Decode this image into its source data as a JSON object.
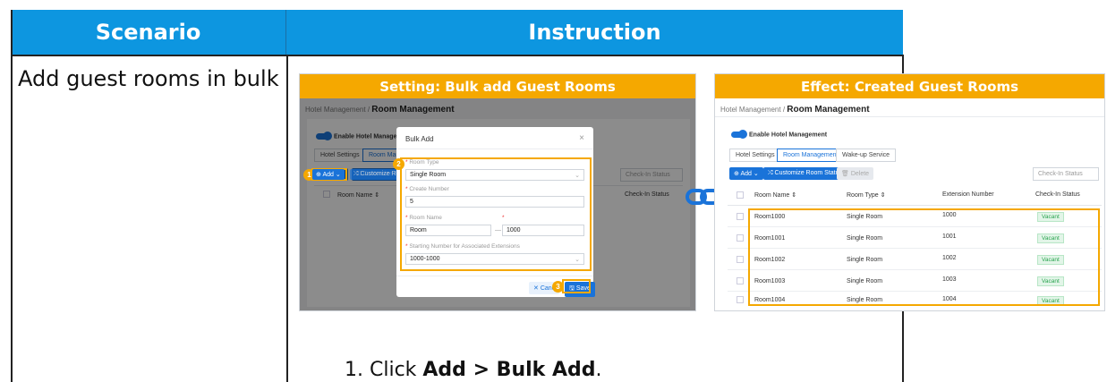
{
  "headers": {
    "scenario": "Scenario",
    "instruction": "Instruction"
  },
  "scenario_text": "Add guest rooms in bulk",
  "setting_panel": {
    "title": "Setting: Bulk add Guest Rooms",
    "breadcrumb_parent": "Hotel Management",
    "breadcrumb_sep": "/",
    "breadcrumb_current": "Room Management",
    "toggle_label": "Enable Hotel Manageme",
    "tabs": [
      "Hotel Settings",
      "Room Mana"
    ],
    "add_button": "Add",
    "customize_button": "Customize Roo",
    "checkin_filter": "Check-In Status",
    "columns": {
      "room_name": "Room Name",
      "checkin": "Check-In Status"
    },
    "modal": {
      "title": "Bulk Add",
      "close": "×",
      "room_type_label": "Room Type",
      "room_type_value": "Single Room",
      "create_number_label": "Create Number",
      "create_number_value": "5",
      "room_name_label": "Room Name",
      "room_name_prefix": "Room",
      "room_name_dash": "—",
      "room_name_start": "1000",
      "ext_label": "Starting Number for Associated Extensions",
      "ext_value": "1000-1000",
      "cancel": "Canc",
      "save": "Save"
    },
    "step_numbers": [
      "1",
      "2",
      "3"
    ]
  },
  "effect_panel": {
    "title": "Effect: Created Guest Rooms",
    "breadcrumb_parent": "Hotel Management",
    "breadcrumb_sep": "/",
    "breadcrumb_current": "Room Management",
    "toggle_label": "Enable Hotel Management",
    "tabs": [
      "Hotel Settings",
      "Room Management",
      "Wake-up Service"
    ],
    "add_button": "Add",
    "customize_button": "Customize Room Status",
    "delete_button": "Delete",
    "checkin_filter": "Check-In Status",
    "columns": [
      "Room Name",
      "Room Type",
      "Extension Number",
      "Check-In Status"
    ],
    "rows": [
      {
        "name": "Room1000",
        "type": "Single Room",
        "ext": "1000",
        "status": "Vacant"
      },
      {
        "name": "Room1001",
        "type": "Single Room",
        "ext": "1001",
        "status": "Vacant"
      },
      {
        "name": "Room1002",
        "type": "Single Room",
        "ext": "1002",
        "status": "Vacant"
      },
      {
        "name": "Room1003",
        "type": "Single Room",
        "ext": "1003",
        "status": "Vacant"
      },
      {
        "name": "Room1004",
        "type": "Single Room",
        "ext": "1004",
        "status": "Vacant"
      }
    ]
  },
  "instruction_step": {
    "prefix": "1. Click ",
    "bold": "Add > Bulk Add",
    "suffix": "."
  },
  "colors": {
    "header_blue": "#0d96e0",
    "accent_orange": "#f5a800",
    "primary_blue": "#1a73d9",
    "vacant_green": "#2aa44f"
  }
}
